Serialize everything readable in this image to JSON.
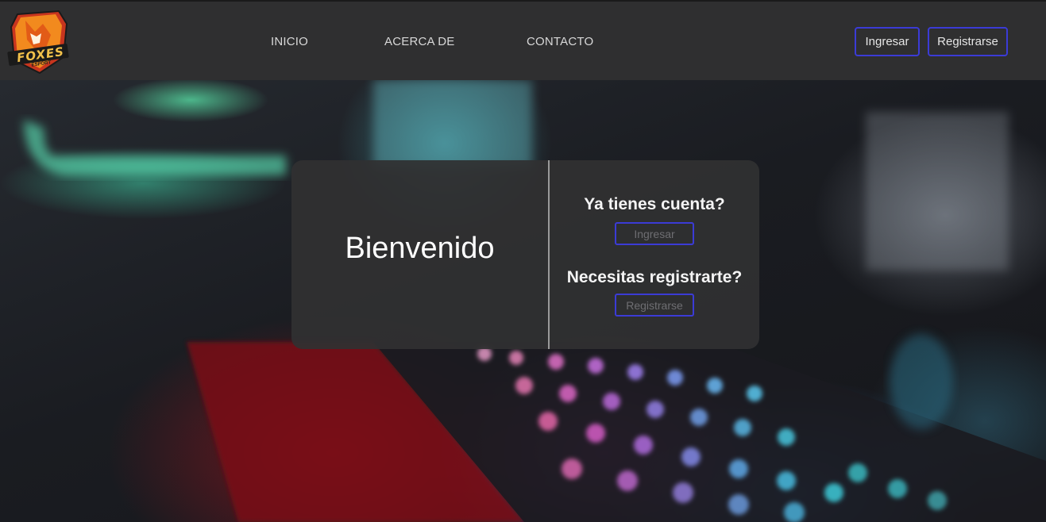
{
  "navbar": {
    "logo_text": "FOXES",
    "logo_subtext": "ESPORT",
    "links": [
      "INICIO",
      "ACERCA DE",
      "CONTACTO"
    ],
    "login_label": "Ingresar",
    "register_label": "Registrarse"
  },
  "card": {
    "welcome": "Bienvenido",
    "have_account_question": "Ya tienes cuenta?",
    "login_label": "Ingresar",
    "need_register_question": "Necesitas registrarte?",
    "register_label": "Registrarse"
  },
  "colors": {
    "navbar_bg": "#2f2f30",
    "accent_border": "#3b3bd6",
    "card_bg": "#303032",
    "logo_orange": "#f28a1e"
  }
}
